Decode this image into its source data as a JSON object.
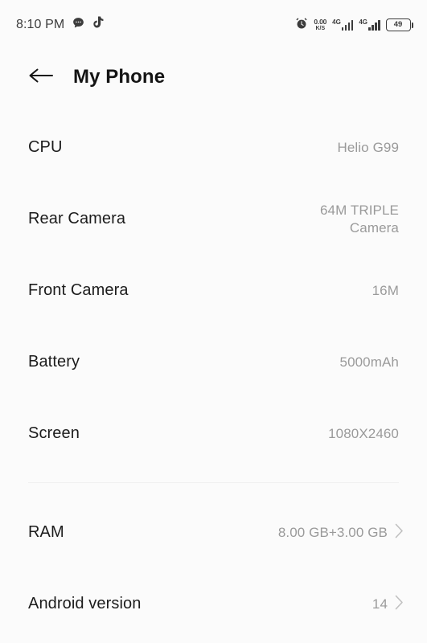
{
  "status_bar": {
    "time": "8:10 PM",
    "left_icons": [
      "chat-bubble-icon",
      "tiktok-icon"
    ],
    "network_speed_value": "0.00",
    "network_speed_unit": "K/S",
    "alarm_icon": "alarm-clock-icon",
    "sim1_network": "4G",
    "sim2_network": "4G",
    "battery_level": "49"
  },
  "header": {
    "back_icon": "back-arrow-icon",
    "title": "My Phone"
  },
  "list": {
    "rows": [
      {
        "label": "CPU",
        "value": "Helio G99",
        "chevron": false
      },
      {
        "label": "Rear Camera",
        "value": "64M TRIPLE Camera",
        "chevron": false
      },
      {
        "label": "Front Camera",
        "value": "16M",
        "chevron": false
      },
      {
        "label": "Battery",
        "value": "5000mAh",
        "chevron": false
      },
      {
        "label": "Screen",
        "value": "1080X2460",
        "chevron": false
      },
      {
        "label": "RAM",
        "value": "8.00 GB+3.00 GB",
        "chevron": true
      },
      {
        "label": "Android version",
        "value": "14",
        "chevron": true
      }
    ]
  },
  "colors": {
    "background": "#fbfbfb",
    "label": "#1c1c1c",
    "value": "#9a9a9a",
    "divider": "#f0f0f0",
    "status_icon": "#3c3c3c"
  }
}
